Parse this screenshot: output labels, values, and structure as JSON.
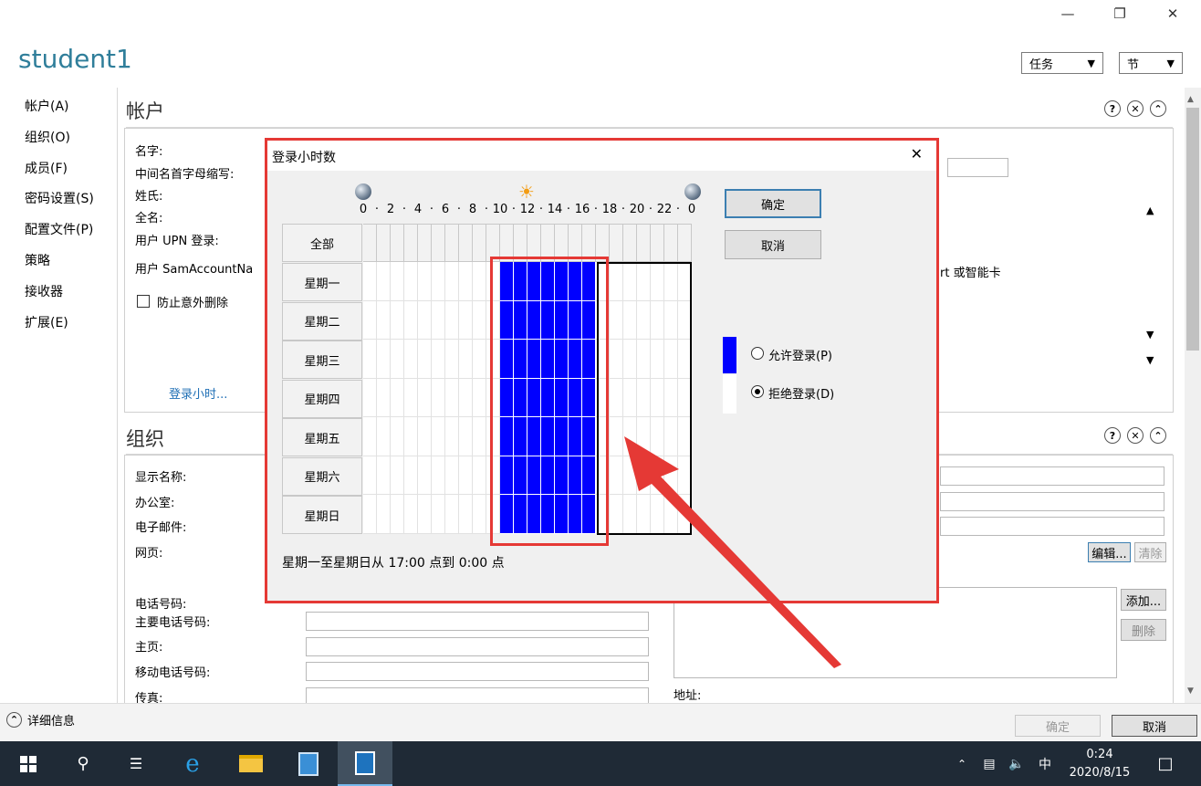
{
  "window": {
    "title": "student1",
    "minimize_icon": "minimize-icon",
    "restore_icon": "restore-icon",
    "close_icon": "close-icon"
  },
  "header": {
    "tasks_label": "任务",
    "sections_label": "节"
  },
  "nav": {
    "items": [
      "帐户(A)",
      "组织(O)",
      "成员(F)",
      "密码设置(S)",
      "配置文件(P)",
      "策略",
      "接收器",
      "扩展(E)"
    ]
  },
  "account": {
    "title": "帐户",
    "labels": [
      "名字:",
      "中间名首字母缩写:",
      "姓氏:",
      "全名:",
      "用户 UPN 登录:",
      "用户 SamAccountNa"
    ],
    "protect_label": "防止意外删除",
    "logon_hours_link": "登录小时...",
    "smartcard_text": "rt 或智能卡"
  },
  "org": {
    "title": "组织",
    "labels": [
      "显示名称:",
      "办公室:",
      "电子邮件:",
      "网页:"
    ],
    "phone_labels": [
      "电话号码:",
      "主要电话号码:",
      "主页:",
      "移动电话号码:",
      "传真:"
    ],
    "address_label": "地址:",
    "edit_label": "编辑...",
    "clear_label": "清除",
    "add_label": "添加...",
    "remove_label": "删除"
  },
  "footer": {
    "details_label": "详细信息",
    "ok_label": "确定",
    "cancel_label": "取消"
  },
  "dialog": {
    "title": "登录小时数",
    "ok_label": "确定",
    "cancel_label": "取消",
    "all_label": "全部",
    "days": [
      "星期一",
      "星期二",
      "星期三",
      "星期四",
      "星期五",
      "星期六",
      "星期日"
    ],
    "hour_labels": [
      "0",
      "2",
      "4",
      "6",
      "8",
      "10",
      "12",
      "14",
      "16",
      "18",
      "20",
      "22",
      "0"
    ],
    "allow_label": "允许登录(P)",
    "deny_label": "拒绝登录(D)",
    "status_text": "星期一至星期日从 17:00 点到 0:00 点",
    "allowed_hours": [
      10,
      17
    ],
    "colors": {
      "allowed": "#0000ff",
      "grid": "#d0d0d0",
      "annotation": "#e53935"
    }
  },
  "taskbar": {
    "time": "0:24",
    "date": "2020/8/15",
    "ime": "中"
  }
}
